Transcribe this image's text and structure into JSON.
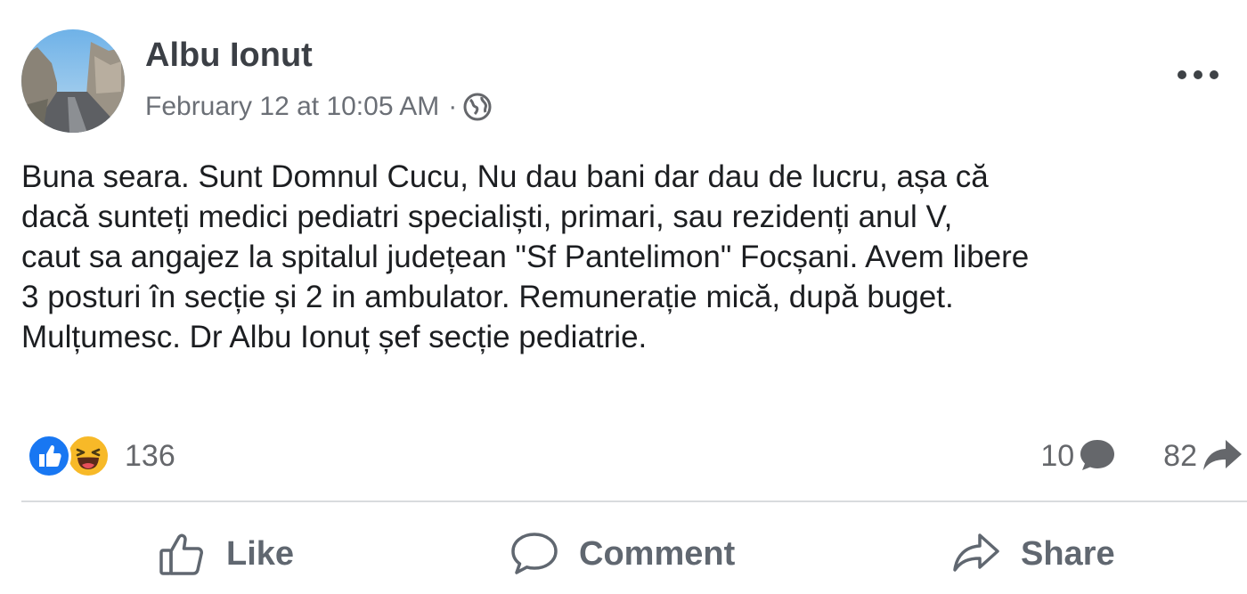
{
  "post": {
    "author": "Albu Ionut",
    "timestamp": "February 12 at 10:05 AM",
    "separator": "·",
    "privacy_icon": "globe-icon",
    "more_icon": "more-options-icon",
    "text_lines": [
      "Buna seara. Sunt Domnul Cucu, Nu dau bani dar dau de lucru, așa că",
      "dacă sunteți medici pediatri specialiști, primari, sau rezidenți anul V,",
      "caut sa angajez la spitalul județean \"Sf Pantelimon\" Focșani. Avem libere",
      "3 posturi în secție și 2 in ambulator. Remunerație mică, după buget.",
      "Mulțumesc. Dr Albu Ionuț șef secție pediatrie."
    ]
  },
  "stats": {
    "reaction_icons": [
      "like-reaction-icon",
      "haha-reaction-icon"
    ],
    "reactions_count": "136",
    "comments_count": "10",
    "shares_count": "82"
  },
  "actions": {
    "like_label": "Like",
    "comment_label": "Comment",
    "share_label": "Share"
  },
  "colors": {
    "like_blue": "#1877f2",
    "haha_yellow": "#f7b928",
    "secondary_text": "#65676b"
  }
}
